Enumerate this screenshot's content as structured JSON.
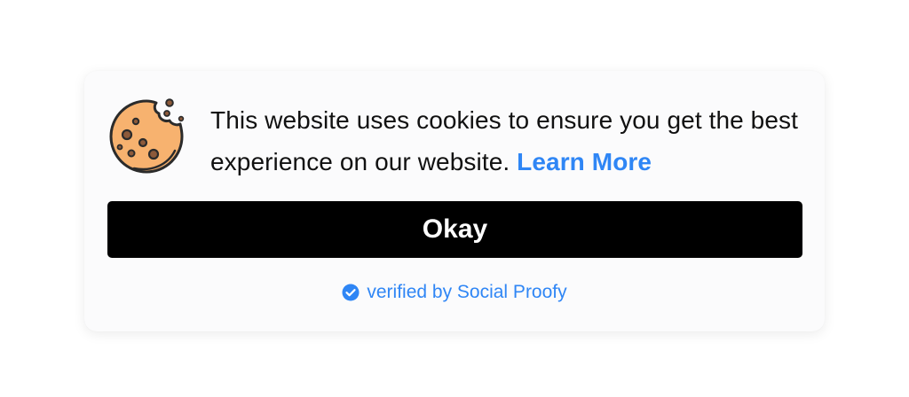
{
  "banner": {
    "message": "This website uses cookies to ensure you get the best experience on our website.",
    "learn_more_label": "Learn More",
    "okay_label": "Okay",
    "verified_label": "verified by Social Proofy",
    "icons": {
      "cookie": "cookie-icon",
      "verified": "check-circle-icon"
    },
    "colors": {
      "accent": "#2f86f5",
      "button_bg": "#000000",
      "button_text": "#ffffff",
      "cookie_fill": "#f7b26f"
    }
  }
}
